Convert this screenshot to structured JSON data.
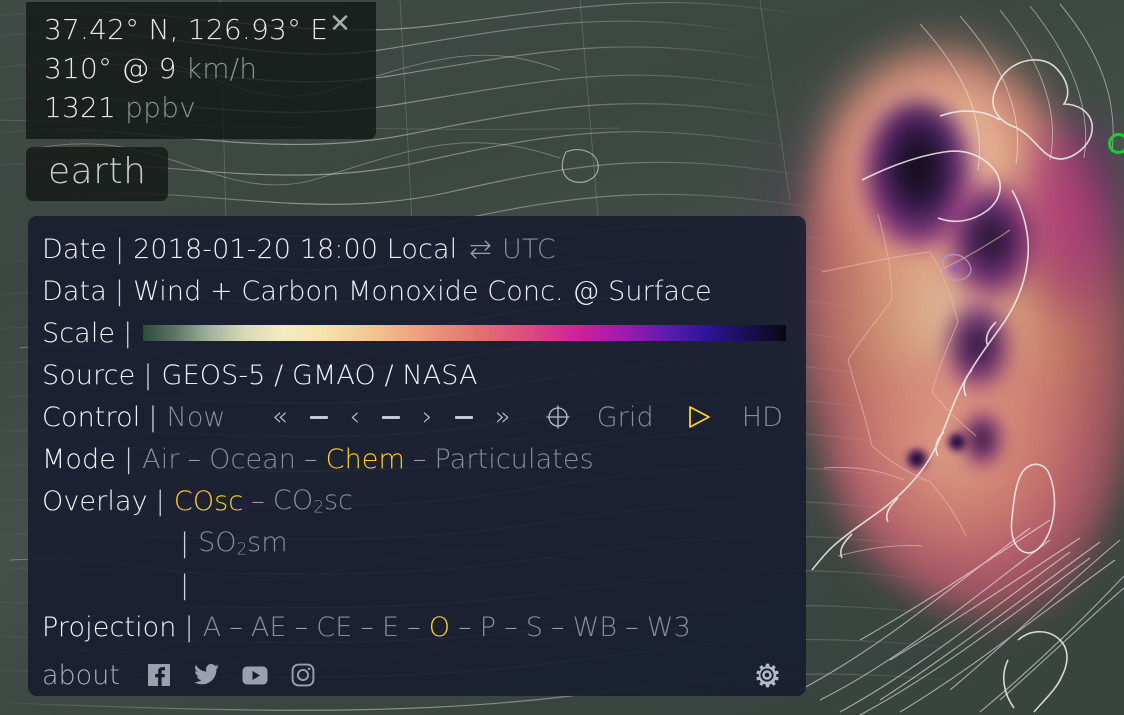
{
  "location": {
    "coordinates": "37.42° N, 126.93° E",
    "wind_direction": "310° @ 9",
    "wind_unit": "km/h",
    "value": "1321",
    "value_unit": "ppbv",
    "close_icon": "close-icon"
  },
  "logo": {
    "text": "earth"
  },
  "menu": {
    "date": {
      "label": "Date",
      "separator": "|",
      "value": "2018-01-20 18:00 Local",
      "toggle_icon": "⇄",
      "alt_zone": "UTC"
    },
    "data": {
      "label": "Data",
      "separator": "|",
      "value": "Wind + Carbon Monoxide Conc. @ Surface"
    },
    "scale": {
      "label": "Scale",
      "separator": "|",
      "gradient_stops": [
        "#2f4a3e",
        "#9fae9b",
        "#f3ecc0",
        "#f2c48d",
        "#e4726f",
        "#cf1e9b",
        "#5a1aaf",
        "#1a0f50",
        "#090814"
      ]
    },
    "source": {
      "label": "Source",
      "separator": "|",
      "value": "GEOS-5 / GMAO / NASA"
    },
    "control": {
      "label": "Control",
      "separator": "|",
      "now_label": "Now",
      "buttons": [
        "«",
        "–",
        "‹",
        "–",
        "›",
        "–",
        "»"
      ],
      "crosshair_icon": "crosshair-icon",
      "grid_label": "Grid",
      "play_icon": "play-icon",
      "hd_label": "HD"
    },
    "mode": {
      "label": "Mode",
      "separator": "|",
      "options": [
        {
          "label": "Air",
          "active": false
        },
        {
          "label": "Ocean",
          "active": false
        },
        {
          "label": "Chem",
          "active": true
        },
        {
          "label": "Particulates",
          "active": false
        }
      ],
      "divider": "–"
    },
    "overlay": {
      "label": "Overlay",
      "separator": "|",
      "row1": [
        {
          "label": "COsc",
          "active": true
        },
        {
          "label": "CO",
          "sub": "2",
          "suffix": "sc",
          "active": false
        }
      ],
      "row2": [
        {
          "label": "SO",
          "sub": "2",
          "suffix": "sm",
          "active": false
        }
      ],
      "row3": [],
      "divider": "–"
    },
    "projection": {
      "label": "Projection",
      "separator": "|",
      "options": [
        {
          "label": "A",
          "active": false
        },
        {
          "label": "AE",
          "active": false
        },
        {
          "label": "CE",
          "active": false
        },
        {
          "label": "E",
          "active": false
        },
        {
          "label": "O",
          "active": true
        },
        {
          "label": "P",
          "active": false
        },
        {
          "label": "S",
          "active": false
        },
        {
          "label": "WB",
          "active": false
        },
        {
          "label": "W3",
          "active": false
        }
      ],
      "divider": "–"
    },
    "footer": {
      "about_label": "about",
      "social": [
        "facebook-icon",
        "twitter-icon",
        "youtube-icon",
        "instagram-icon"
      ],
      "settings_icon": "gear-icon"
    }
  },
  "map": {
    "marker": "green-location-marker",
    "colors": {
      "background": "#3d4742",
      "accent_gold": "#ffd024",
      "marker_green": "#14d22e",
      "panel_bg": "#171d30"
    }
  }
}
